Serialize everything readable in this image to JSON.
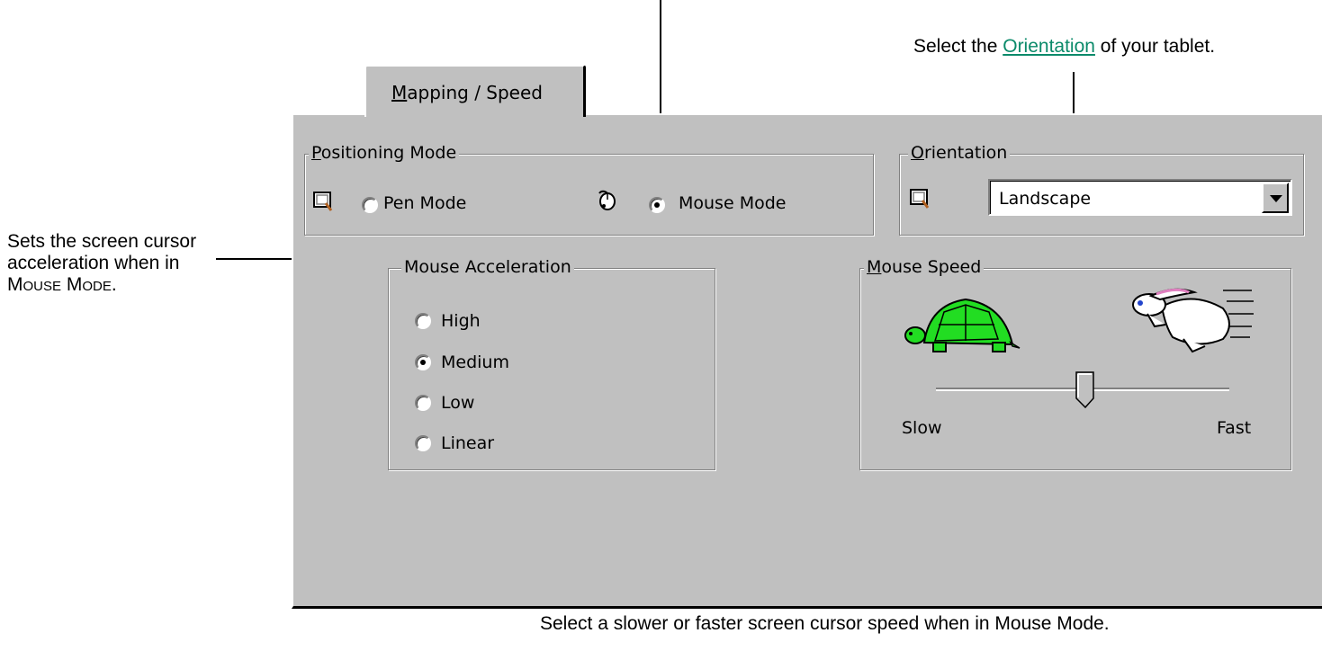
{
  "callouts": {
    "orientation_prefix": "Select the ",
    "orientation_link": "Orientation",
    "orientation_suffix": " of your tablet.",
    "accel_line1": "Sets the screen cursor",
    "accel_line2": "acceleration when in",
    "accel_line3": "Mouse Mode.",
    "speed": "Select a slower or faster screen cursor speed when in Mouse Mode."
  },
  "tab": {
    "label_first": "M",
    "label_rest": "apping / Speed"
  },
  "positioning_mode": {
    "legend_first": "P",
    "legend_rest": "ositioning Mode",
    "pen_label": "Pen Mode",
    "mouse_label": "Mouse Mode",
    "selected": "mouse"
  },
  "orientation": {
    "legend_first": "O",
    "legend_rest": "rientation",
    "value": "Landscape"
  },
  "mouse_acceleration": {
    "legend": "Mouse Acceleration",
    "options": [
      "High",
      "Medium",
      "Low",
      "Linear"
    ],
    "selected": "Medium"
  },
  "mouse_speed": {
    "legend_first": "M",
    "legend_rest": "ouse Speed",
    "slow_label": "Slow",
    "fast_label": "Fast",
    "value_fraction": 0.51
  },
  "icons": {
    "tablet": "tablet-icon",
    "mouse": "mouse-icon",
    "turtle": "turtle-icon",
    "rabbit": "rabbit-icon",
    "dropdown": "chevron-down-icon"
  },
  "colors": {
    "panel": "#c0c0c0",
    "link": "#0b8a6a",
    "turtle": "#22dd22"
  }
}
